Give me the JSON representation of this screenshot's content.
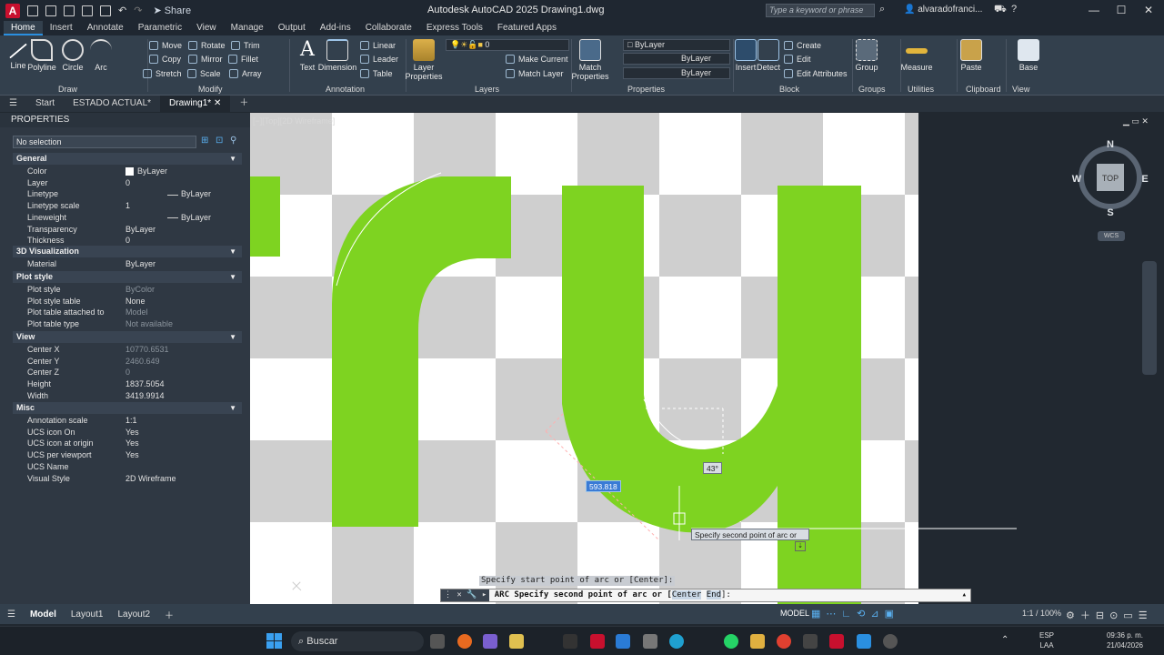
{
  "titlebar": {
    "app_title": "Autodesk AutoCAD 2025    Drawing1.dwg",
    "share": "Share",
    "search_placeholder": "Type a keyword or phrase",
    "user": "alvaradofranci..."
  },
  "tabs": [
    "Home",
    "Insert",
    "Annotate",
    "Parametric",
    "View",
    "Manage",
    "Output",
    "Add-ins",
    "Collaborate",
    "Express Tools",
    "Featured Apps"
  ],
  "ribbon": {
    "draw": {
      "label": "Draw",
      "line": "Line",
      "polyline": "Polyline",
      "circle": "Circle",
      "arc": "Arc"
    },
    "modify": {
      "label": "Modify",
      "move": "Move",
      "rotate": "Rotate",
      "trim": "Trim",
      "copy": "Copy",
      "mirror": "Mirror",
      "fillet": "Fillet",
      "stretch": "Stretch",
      "scale": "Scale",
      "array": "Array"
    },
    "annotation": {
      "label": "Annotation",
      "text": "Text",
      "dimension": "Dimension",
      "linear": "Linear",
      "leader": "Leader",
      "table": "Table"
    },
    "layers": {
      "label": "Layers",
      "layer_properties": "Layer Properties",
      "layer_value": "0",
      "make_current": "Make Current",
      "match_layer": "Match Layer"
    },
    "properties": {
      "label": "Properties",
      "match_properties": "Match Properties",
      "color": "ByLayer",
      "linetype": "ByLayer",
      "lineweight": "ByLayer"
    },
    "block": {
      "label": "Block",
      "insert": "Insert",
      "detect": "Detect",
      "create": "Create",
      "edit": "Edit",
      "edit_attributes": "Edit Attributes"
    },
    "groups": {
      "label": "Groups",
      "group": "Group"
    },
    "utilities": {
      "label": "Utilities",
      "measure": "Measure"
    },
    "clipboard": {
      "label": "Clipboard",
      "paste": "Paste"
    },
    "view": {
      "label": "View",
      "base": "Base"
    }
  },
  "filetabs": {
    "start": "Start",
    "estado": "ESTADO ACTUAL*",
    "drawing": "Drawing1*"
  },
  "properties": {
    "header": "PROPERTIES",
    "selection": "No selection",
    "sections": {
      "general": "General",
      "vis3d": "3D Visualization",
      "plot": "Plot style",
      "view": "View",
      "misc": "Misc"
    },
    "general": [
      [
        "Color",
        "ByLayer"
      ],
      [
        "Layer",
        "0"
      ],
      [
        "Linetype",
        "ByLayer"
      ],
      [
        "Linetype scale",
        "1"
      ],
      [
        "Lineweight",
        "ByLayer"
      ],
      [
        "Transparency",
        "ByLayer"
      ],
      [
        "Thickness",
        "0"
      ]
    ],
    "vis3d": [
      [
        "Material",
        "ByLayer"
      ]
    ],
    "plot": [
      [
        "Plot style",
        "ByColor"
      ],
      [
        "Plot style table",
        "None"
      ],
      [
        "Plot table attached to",
        "Model"
      ],
      [
        "Plot table type",
        "Not available"
      ]
    ],
    "view": [
      [
        "Center X",
        "10770.6531"
      ],
      [
        "Center Y",
        "2460.649"
      ],
      [
        "Center Z",
        "0"
      ],
      [
        "Height",
        "1837.5054"
      ],
      [
        "Width",
        "3419.9914"
      ]
    ],
    "misc": [
      [
        "Annotation scale",
        "1:1"
      ],
      [
        "UCS icon On",
        "Yes"
      ],
      [
        "UCS icon at origin",
        "Yes"
      ],
      [
        "UCS per viewport",
        "Yes"
      ],
      [
        "UCS Name",
        ""
      ],
      [
        "Visual Style",
        "2D Wireframe"
      ]
    ]
  },
  "viewport": {
    "label": "[−][Top][2D Wireframe]",
    "compass": {
      "n": "N",
      "s": "S",
      "e": "E",
      "w": "W",
      "top": "TOP"
    },
    "wcs": "WCS"
  },
  "tooltips": {
    "length": "593.818",
    "angle": "43°",
    "prompt": "Specify second point of arc or"
  },
  "command": {
    "history": "Specify start point of arc or [Center]:",
    "current_prefix": "ARC Specify second point of arc or [",
    "opt1": "Center",
    "opt2": "End",
    "suffix": "]:"
  },
  "statusbar": {
    "model": "Model",
    "layout1": "Layout1",
    "layout2": "Layout2",
    "model_right": "MODEL",
    "scale": "1:1 / 100%"
  },
  "taskbar": {
    "search": "Buscar",
    "lang1": "ESP",
    "lang2": "LAA",
    "time": "09:36 p. m.",
    "date": "21/04/2026"
  }
}
